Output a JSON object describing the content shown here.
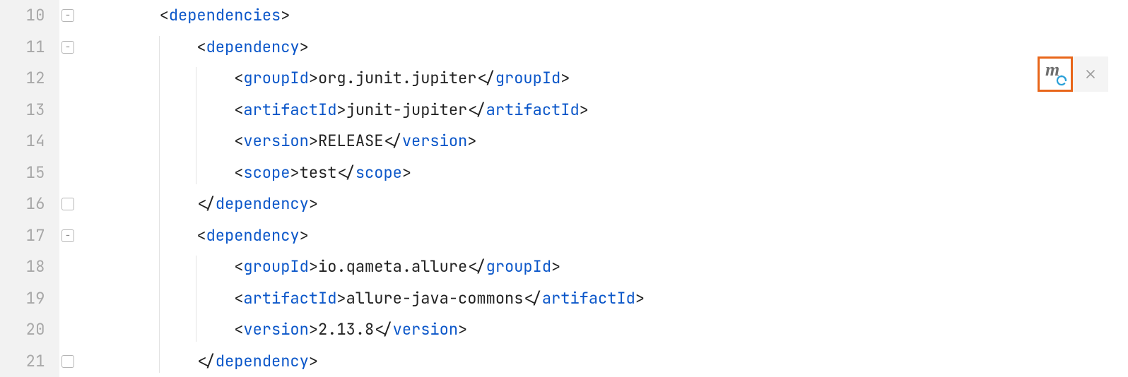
{
  "line_numbers": [
    "10",
    "11",
    "12",
    "13",
    "14",
    "15",
    "16",
    "17",
    "18",
    "19",
    "20",
    "21"
  ],
  "folds": [
    {
      "row": 0,
      "type": "minus"
    },
    {
      "row": 1,
      "type": "minus"
    },
    {
      "row": 6,
      "type": "blank"
    },
    {
      "row": 7,
      "type": "minus"
    },
    {
      "row": 11,
      "type": "blank"
    }
  ],
  "code": [
    {
      "indent": 1,
      "open": true,
      "tag": "dependencies",
      "text": null,
      "close": false
    },
    {
      "indent": 2,
      "open": true,
      "tag": "dependency",
      "text": null,
      "close": false
    },
    {
      "indent": 3,
      "open": true,
      "tag": "groupId",
      "text": "org.junit.jupiter",
      "close": true
    },
    {
      "indent": 3,
      "open": true,
      "tag": "artifactId",
      "text": "junit-jupiter",
      "close": true
    },
    {
      "indent": 3,
      "open": true,
      "tag": "version",
      "text": "RELEASE",
      "close": true
    },
    {
      "indent": 3,
      "open": true,
      "tag": "scope",
      "text": "test",
      "close": true
    },
    {
      "indent": 2,
      "open": false,
      "tag": "dependency",
      "text": null,
      "close": true
    },
    {
      "indent": 2,
      "open": true,
      "tag": "dependency",
      "text": null,
      "close": false
    },
    {
      "indent": 3,
      "open": true,
      "tag": "groupId",
      "text": "io.qameta.allure",
      "close": true
    },
    {
      "indent": 3,
      "open": true,
      "tag": "artifactId",
      "text": "allure-java-commons",
      "close": true
    },
    {
      "indent": 3,
      "open": true,
      "tag": "version",
      "text": "2.13.8",
      "close": true
    },
    {
      "indent": 2,
      "open": false,
      "tag": "dependency",
      "text": null,
      "close": true
    }
  ],
  "guides": [
    {
      "col": 1,
      "fromRow": 1,
      "toRow": 11
    },
    {
      "col": 2,
      "fromRow": 2,
      "toRow": 5
    },
    {
      "col": 2,
      "fromRow": 8,
      "toRow": 10
    }
  ],
  "floating": {
    "maven_tooltip": "Load Maven Changes",
    "close_tooltip": "Close"
  }
}
